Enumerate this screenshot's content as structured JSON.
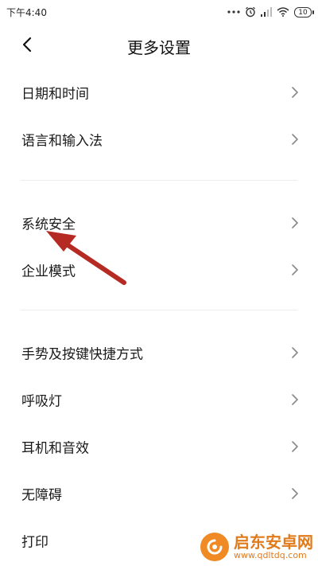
{
  "status_bar": {
    "time": "下午4:40",
    "battery": "10",
    "icons": [
      "dots-icon",
      "alarm-icon",
      "signal-icon",
      "wifi-icon",
      "battery-icon"
    ]
  },
  "header": {
    "title": "更多设置",
    "back_icon": "chevron-left-icon"
  },
  "sections": [
    {
      "items": [
        {
          "label": "日期和时间"
        },
        {
          "label": "语言和输入法"
        }
      ]
    },
    {
      "items": [
        {
          "label": "系统安全"
        },
        {
          "label": "企业模式"
        }
      ]
    },
    {
      "items": [
        {
          "label": "手势及按键快捷方式"
        },
        {
          "label": "呼吸灯"
        },
        {
          "label": "耳机和音效"
        },
        {
          "label": "无障碍"
        },
        {
          "label": "打印"
        }
      ]
    }
  ],
  "annotation": {
    "color": "#b52a22",
    "points_to": "系统安全"
  },
  "watermark": {
    "title": "启东安卓网",
    "url": "www.qdltdq.com",
    "color": "#e07a1a"
  }
}
